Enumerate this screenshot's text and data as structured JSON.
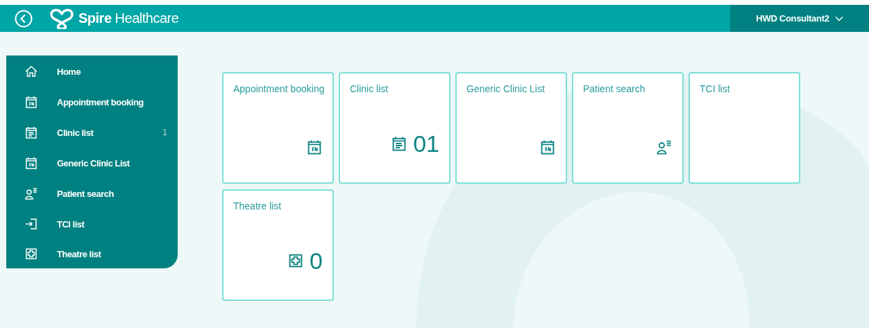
{
  "header": {
    "brand": {
      "name": "Spire",
      "suffix": "Healthcare"
    },
    "user": "HWD Consultant2"
  },
  "sidebar": {
    "items": [
      {
        "label": "Home",
        "kind": "home"
      },
      {
        "label": "Appointment booking",
        "kind": "calendar"
      },
      {
        "label": "Clinic list",
        "kind": "clinic",
        "count": "1"
      },
      {
        "label": "Generic Clinic List",
        "kind": "calendar"
      },
      {
        "label": "Patient search",
        "kind": "patient"
      },
      {
        "label": "TCI list",
        "kind": "enter"
      },
      {
        "label": "Theatre list",
        "kind": "theatre"
      }
    ]
  },
  "tiles": [
    {
      "title": "Appointment booking",
      "kind": "calendar"
    },
    {
      "title": "Clinic list",
      "kind": "clinic",
      "count": "01"
    },
    {
      "title": "Generic Clinic List",
      "kind": "calendar"
    },
    {
      "title": "Patient search",
      "kind": "patient"
    },
    {
      "title": "TCI list",
      "kind": "blank"
    },
    {
      "title": "Theatre list",
      "kind": "theatre",
      "count": "0"
    }
  ]
}
